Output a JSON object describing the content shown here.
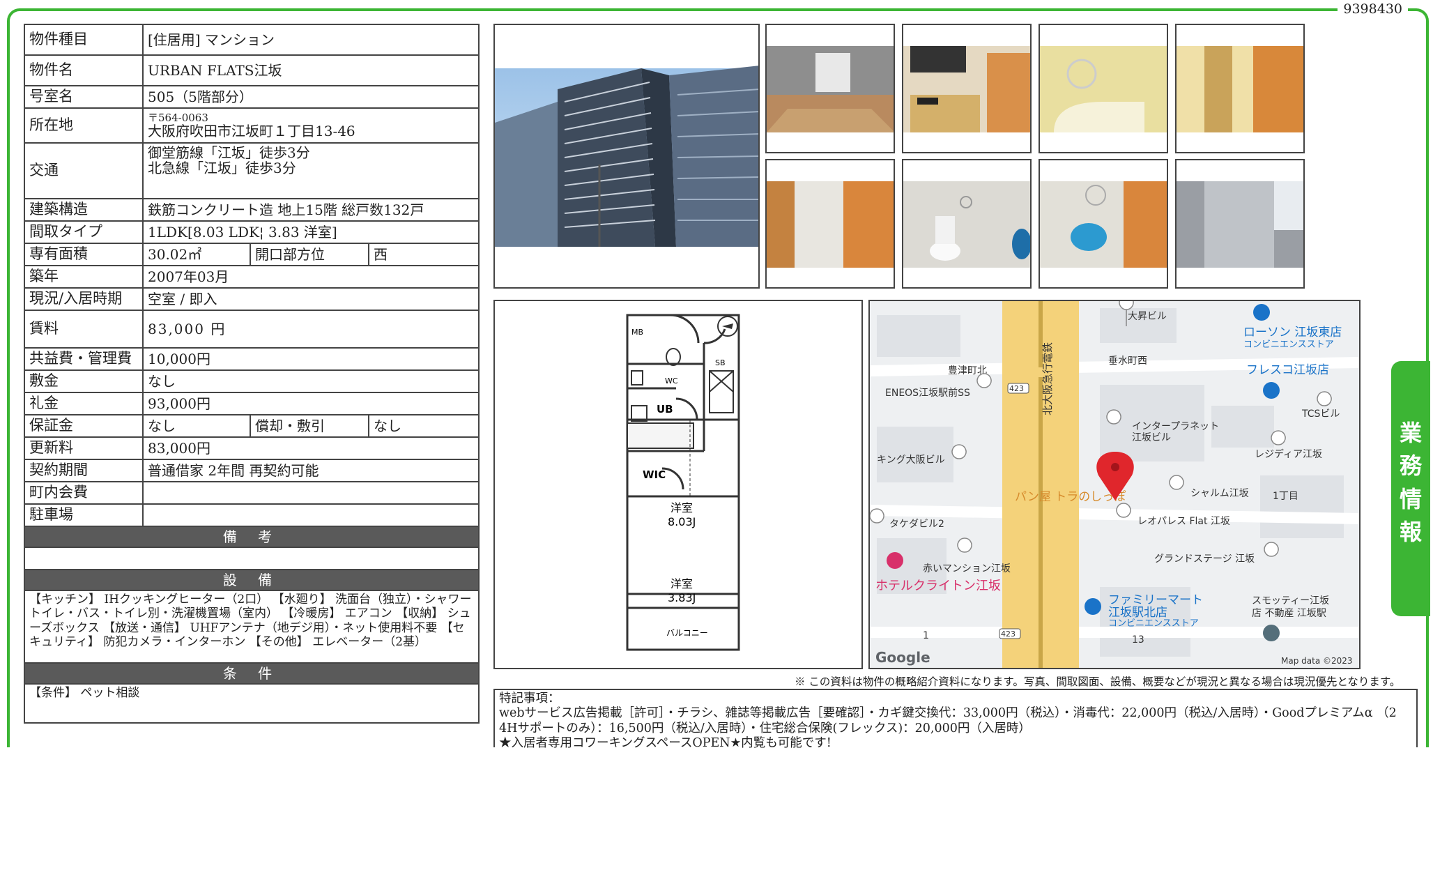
{
  "doc_id": "9398430",
  "rows": {
    "type_label": "物件種目",
    "type_value": "[住居用] マンション",
    "name_label": "物件名",
    "name_value": "URBAN FLATS江坂",
    "room_label": "号室名",
    "room_value": "505（5階部分）",
    "addr_label": "所在地",
    "addr_zip": "〒564-0063",
    "addr_value": "大阪府吹田市江坂町１丁目13-46",
    "transit_label": "交通",
    "transit_1": "御堂筋線「江坂」徒歩3分",
    "transit_2": "北急線「江坂」徒歩3分",
    "struct_label": "建築構造",
    "struct_value": "鉄筋コンクリート造 地上15階 総戸数132戸",
    "layout_label": "間取タイプ",
    "layout_value": "1LDK[8.03 LDK¦ 3.83 洋室]",
    "area_label": "専有面積",
    "area_value": "30.02㎡",
    "opening_label": "開口部方位",
    "opening_value": "西",
    "built_label": "築年",
    "built_value": "2007年03月",
    "status_label": "現況/入居時期",
    "status_value": "空室 / 即入",
    "rent_label": "賃料",
    "rent_value": "83,000 円",
    "fee_label": "共益費・管理費",
    "fee_value": "10,000円",
    "deposit_label": "敷金",
    "deposit_value": "なし",
    "key_label": "礼金",
    "key_value": "93,000円",
    "guarantee_label": "保証金",
    "guarantee_value": "なし",
    "amort_label": "償却・敷引",
    "amort_value": "なし",
    "renew_label": "更新料",
    "renew_value": "83,000円",
    "contract_label": "契約期間",
    "contract_value": "普通借家 2年間 再契約可能",
    "assoc_label": "町内会費",
    "assoc_value": "",
    "parking_label": "駐車場",
    "parking_value": ""
  },
  "sections": {
    "remarks_title": "備 考",
    "remarks_text": "",
    "equipment_title": "設 備",
    "equipment_text": "【キッチン】 IHクッキングヒーター（2口） 【水廻り】 洗面台（独立）・シャワートイレ・バス・トイレ別・洗濯機置場（室内） 【冷暖房】 エアコン 【収納】 シューズボックス 【放送・通信】 UHFアンテナ（地デジ用）・ネット使用料不要 【セキュリティ】 防犯カメラ・インターホン 【その他】 エレベーター（2基）",
    "conditions_title": "条 件",
    "conditions_text": "【条件】 ペット相談"
  },
  "floorplan": {
    "mb": "MB",
    "sb": "SB",
    "wc": "WC",
    "ub": "UB",
    "wic": "WIC",
    "room1": "洋室",
    "room1_size": "8.03J",
    "room2": "洋室",
    "room2_size": "3.83J",
    "balcony": "バルコニー"
  },
  "map": {
    "labels": [
      "大昇ビル",
      "ローソン 江坂東店",
      "コンビニエンスストア",
      "豊津町北",
      "垂水町西",
      "フレスコ江坂店",
      "ENEOS江坂駅前SS",
      "TCSビル",
      "インタープラネット",
      "江坂ビル",
      "キング大阪ビル",
      "レジディア江坂",
      "パン屋 トラのしっぽ",
      "シャルム江坂",
      "1丁目",
      "タケダビル2",
      "レオパレス Flat 江坂",
      "グランドステージ 江坂",
      "赤いマンション江坂",
      "ホテルクライトン江坂",
      "ファミリーマート",
      "江坂駅北店",
      "コンビニエンスストア",
      "スモッティー江坂",
      "店 不動産 江坂駅",
      "北大阪急行電鉄",
      "423",
      "423",
      "1",
      "13",
      "Google",
      "Map data ©2023"
    ]
  },
  "note_top": "※ この資料は物件の概略紹介資料になります。写真、間取図面、設備、概要などが現況と異なる場合は現況優先となります。",
  "special": {
    "title": "特記事項：",
    "line1": "webサービス広告掲載［許可］・チラシ、雑誌等掲載広告［要確認］・カギ鍵交換代：33,000円（税込）・消毒代：22,000円（税込/入居時）・Goodプレミアムα （2",
    "line2": "4Hサポートのみ）：16,500円（税込/入居時）・住宅総合保険(フレックス)：20,000円（入居時）",
    "line3": "★入居者専用コワーキングスペースOPEN★内覧も可能です!"
  },
  "side_tab": [
    "業",
    "務",
    "情",
    "報"
  ],
  "colors": {
    "accent": "#3cb534",
    "section_bg": "#5a5a5a",
    "pin": "#e0262c"
  }
}
